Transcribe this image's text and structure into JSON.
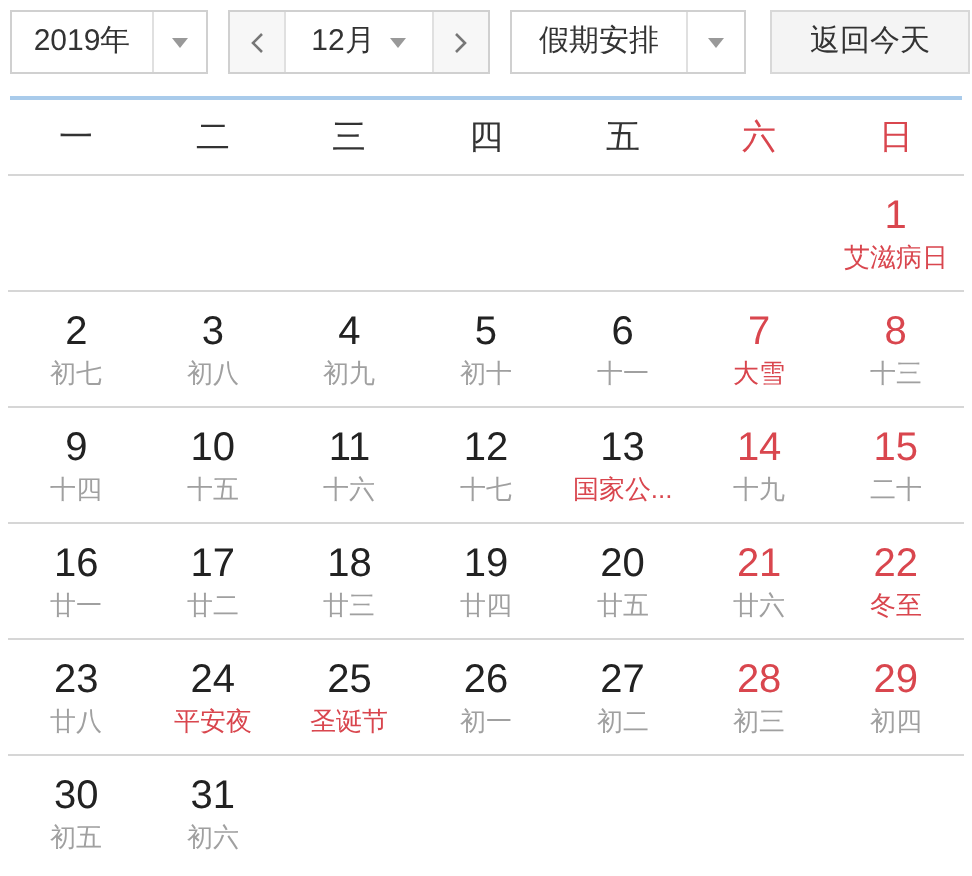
{
  "toolbar": {
    "year": "2019年",
    "month": "12月",
    "holiday_filter": "假期安排",
    "today_button": "返回今天"
  },
  "weekdays": [
    {
      "label": "一",
      "weekend": false
    },
    {
      "label": "二",
      "weekend": false
    },
    {
      "label": "三",
      "weekend": false
    },
    {
      "label": "四",
      "weekend": false
    },
    {
      "label": "五",
      "weekend": false
    },
    {
      "label": "六",
      "weekend": true
    },
    {
      "label": "日",
      "weekend": true
    }
  ],
  "weeks": [
    [
      {
        "day": "1",
        "sub": "艾滋病日",
        "weekend": true,
        "festival": true
      }
    ],
    [
      {
        "day": "2",
        "sub": "初七",
        "weekend": false,
        "festival": false
      },
      {
        "day": "3",
        "sub": "初八",
        "weekend": false,
        "festival": false
      },
      {
        "day": "4",
        "sub": "初九",
        "weekend": false,
        "festival": false
      },
      {
        "day": "5",
        "sub": "初十",
        "weekend": false,
        "festival": false
      },
      {
        "day": "6",
        "sub": "十一",
        "weekend": false,
        "festival": false
      },
      {
        "day": "7",
        "sub": "大雪",
        "weekend": true,
        "festival": true
      },
      {
        "day": "8",
        "sub": "十三",
        "weekend": true,
        "festival": false
      }
    ],
    [
      {
        "day": "9",
        "sub": "十四",
        "weekend": false,
        "festival": false
      },
      {
        "day": "10",
        "sub": "十五",
        "weekend": false,
        "festival": false
      },
      {
        "day": "11",
        "sub": "十六",
        "weekend": false,
        "festival": false
      },
      {
        "day": "12",
        "sub": "十七",
        "weekend": false,
        "festival": false
      },
      {
        "day": "13",
        "sub": "国家公...",
        "weekend": false,
        "festival": true
      },
      {
        "day": "14",
        "sub": "十九",
        "weekend": true,
        "festival": false
      },
      {
        "day": "15",
        "sub": "二十",
        "weekend": true,
        "festival": false
      }
    ],
    [
      {
        "day": "16",
        "sub": "廿一",
        "weekend": false,
        "festival": false
      },
      {
        "day": "17",
        "sub": "廿二",
        "weekend": false,
        "festival": false
      },
      {
        "day": "18",
        "sub": "廿三",
        "weekend": false,
        "festival": false
      },
      {
        "day": "19",
        "sub": "廿四",
        "weekend": false,
        "festival": false
      },
      {
        "day": "20",
        "sub": "廿五",
        "weekend": false,
        "festival": false
      },
      {
        "day": "21",
        "sub": "廿六",
        "weekend": true,
        "festival": false
      },
      {
        "day": "22",
        "sub": "冬至",
        "weekend": true,
        "festival": true
      }
    ],
    [
      {
        "day": "23",
        "sub": "廿八",
        "weekend": false,
        "festival": false
      },
      {
        "day": "24",
        "sub": "平安夜",
        "weekend": false,
        "festival": true
      },
      {
        "day": "25",
        "sub": "圣诞节",
        "weekend": false,
        "festival": true
      },
      {
        "day": "26",
        "sub": "初一",
        "weekend": false,
        "festival": false
      },
      {
        "day": "27",
        "sub": "初二",
        "weekend": false,
        "festival": false
      },
      {
        "day": "28",
        "sub": "初三",
        "weekend": true,
        "festival": false
      },
      {
        "day": "29",
        "sub": "初四",
        "weekend": true,
        "festival": false
      }
    ],
    [
      {
        "day": "30",
        "sub": "初五",
        "weekend": false,
        "festival": false
      },
      {
        "day": "31",
        "sub": "初六",
        "weekend": false,
        "festival": false
      }
    ]
  ]
}
